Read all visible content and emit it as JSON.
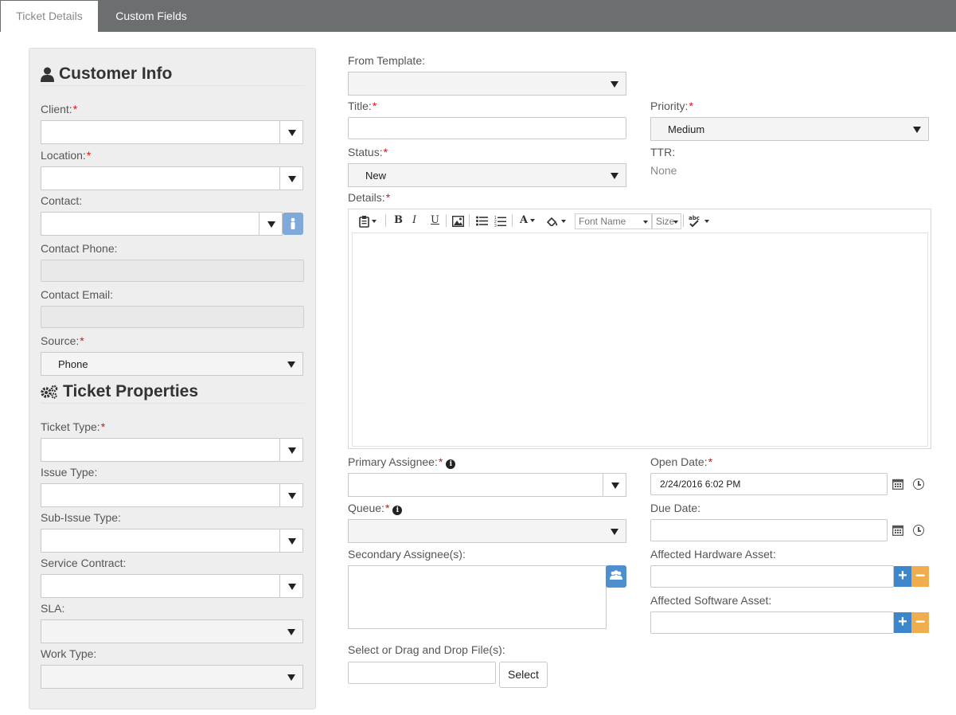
{
  "tabs": [
    {
      "label": "Ticket Details",
      "active": true
    },
    {
      "label": "Custom Fields",
      "active": false
    }
  ],
  "customer_info": {
    "title": "Customer Info",
    "icon": "user-icon",
    "client_label": "Client:",
    "client_value": "",
    "location_label": "Location:",
    "location_value": "",
    "contact_label": "Contact:",
    "contact_value": "",
    "contact_phone_label": "Contact Phone:",
    "contact_phone_value": "",
    "contact_email_label": "Contact Email:",
    "contact_email_value": "",
    "source_label": "Source:",
    "source_value": "Phone"
  },
  "ticket_properties": {
    "title": "Ticket Properties",
    "icon": "gears-icon",
    "ticket_type_label": "Ticket Type:",
    "issue_type_label": "Issue Type:",
    "sub_issue_type_label": "Sub-Issue Type:",
    "service_contract_label": "Service Contract:",
    "sla_label": "SLA:",
    "work_type_label": "Work Type:"
  },
  "form": {
    "from_template_label": "From Template:",
    "from_template_value": "",
    "title_label": "Title:",
    "title_value": "",
    "priority_label": "Priority:",
    "priority_value": "Medium",
    "status_label": "Status:",
    "status_value": "New",
    "ttr_label": "TTR:",
    "ttr_value": "None",
    "details_label": "Details:",
    "editor": {
      "font_name_placeholder": "Font Name",
      "size_placeholder": "Size",
      "bold": "B",
      "italic": "I",
      "underline": "U",
      "font_color": "A"
    },
    "primary_assignee_label": "Primary Assignee:",
    "open_date_label": "Open Date:",
    "open_date_value": "2/24/2016 6:02 PM",
    "queue_label": "Queue:",
    "due_date_label": "Due Date:",
    "due_date_value": "",
    "secondary_assignees_label": "Secondary Assignee(s):",
    "affected_hardware_label": "Affected Hardware Asset:",
    "affected_software_label": "Affected Software Asset:",
    "files_label": "Select or Drag and Drop File(s):",
    "select_button": "Select",
    "required_marker": "*"
  },
  "colors": {
    "tabbar": "#6b6f70",
    "required": "#e01010",
    "primary_button": "#3e86cc",
    "warning_button": "#f0ad4e"
  }
}
